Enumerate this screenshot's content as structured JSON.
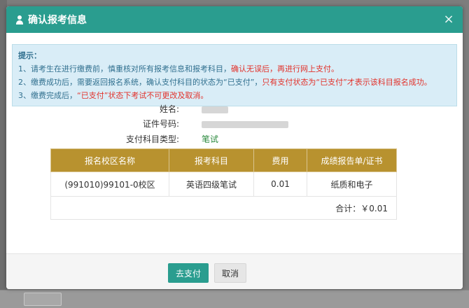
{
  "modal": {
    "title": "确认报考信息",
    "close_glyph": "×"
  },
  "notice": {
    "heading": "提示：",
    "lines": [
      {
        "normal": "1、请考生在进行缴费前，慎重核对所有报考信息和报考科目，",
        "red": "确认无误后，再进行网上支付。",
        "tail": ""
      },
      {
        "normal": "2、缴费成功后，需要返回报名系统，确认支付科目的状态为“已支付”，",
        "red": "只有支付状态为“已支付”才表示该科目报名成功。",
        "tail": ""
      },
      {
        "normal": "3、缴费完成后，",
        "red": "“已支付”",
        "tail": "状态下考试不可更改及取消。"
      }
    ]
  },
  "info": {
    "name_label": "姓名:",
    "id_label": "证件号码:",
    "type_label": "支付科目类型:",
    "type_value": "笔试"
  },
  "table": {
    "headers": [
      "报名校区名称",
      "报考科目",
      "费用",
      "成绩报告单/证书"
    ],
    "rows": [
      [
        "(991010)99101-0校区",
        "英语四级笔试",
        "0.01",
        "纸质和电子"
      ]
    ],
    "total": "合计：￥0.01"
  },
  "footer": {
    "pay_label": "去支付",
    "cancel_label": "取消"
  },
  "colors": {
    "header_bg": "#2a9d8f",
    "table_header_bg": "#b8922f",
    "notice_bg": "#d9edf7",
    "warning_red": "#e2322b",
    "success_green": "#2b8a3e"
  }
}
